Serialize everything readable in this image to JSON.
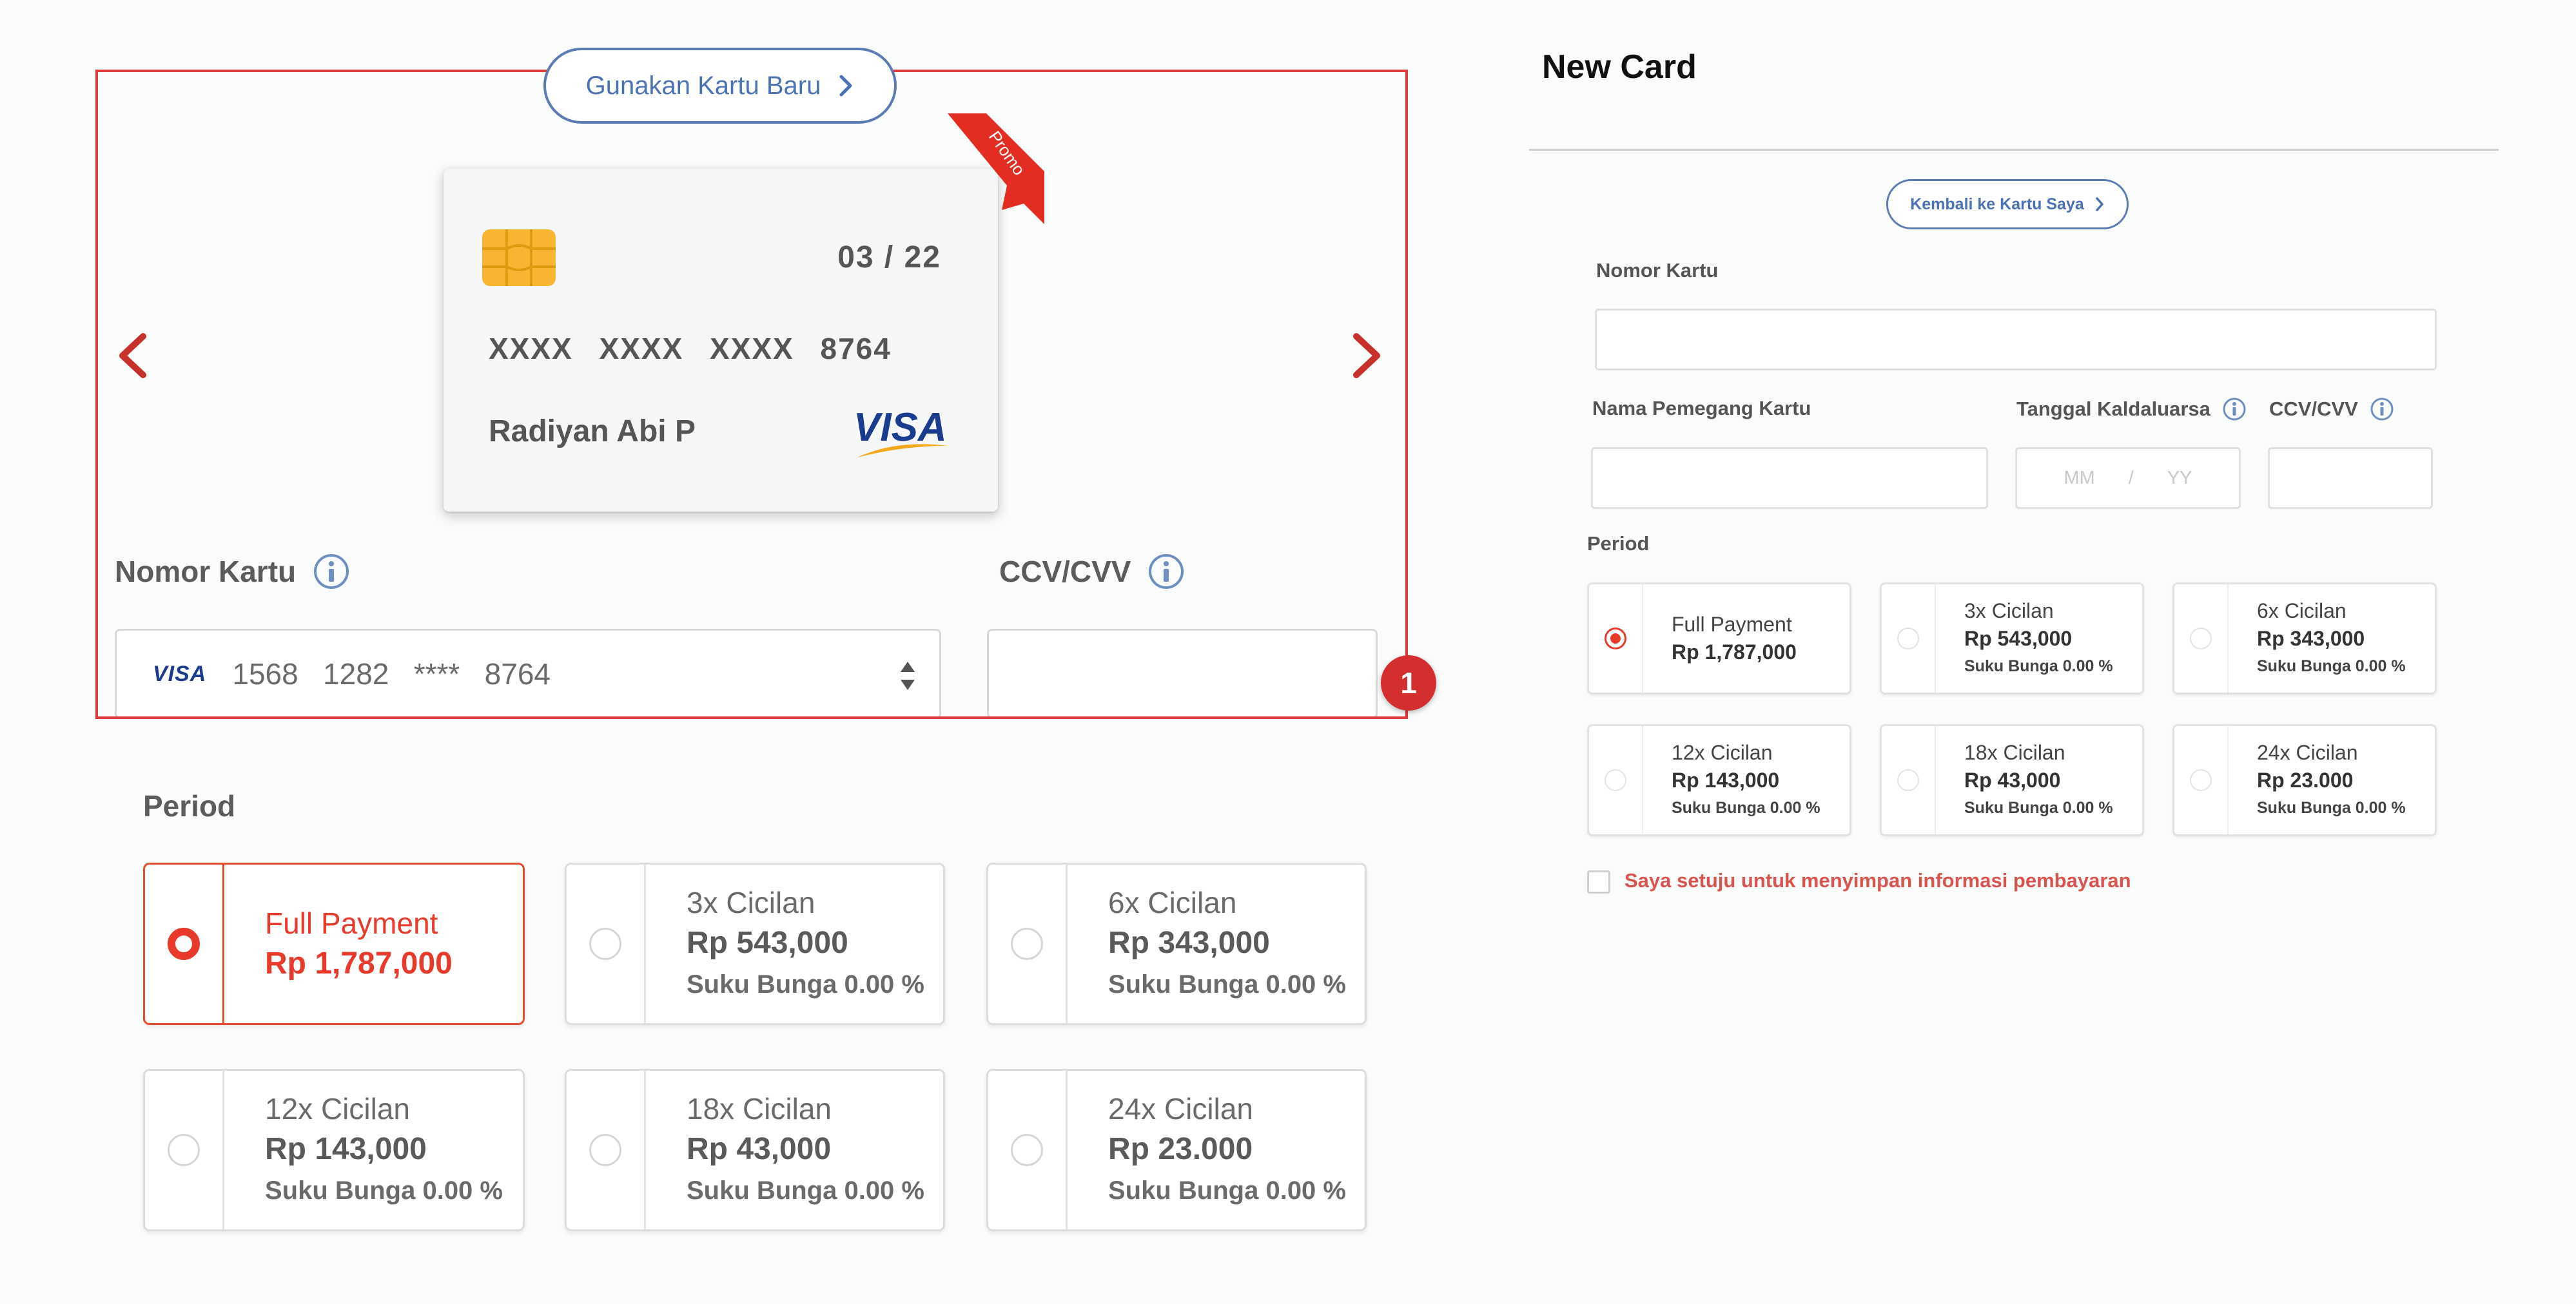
{
  "left_panel": {
    "use_new_card_label": "Gunakan Kartu Baru",
    "card": {
      "expiry": "03 / 22",
      "number": "XXXX XXXX XXXX 8764",
      "holder": "Radiyan Abi P",
      "brand": "VISA",
      "ribbon": "Promo"
    },
    "card_number_label": "Nomor Kartu",
    "card_number_brand": "VISA",
    "card_number_value": "1568   1282   ****   8764",
    "ccv_label": "CCV/CVV",
    "period_label": "Period",
    "badge": "1",
    "options": [
      {
        "title": "Full Payment",
        "amount": "Rp 1,787,000",
        "interest": "",
        "selected": true
      },
      {
        "title": "3x Cicilan",
        "amount": "Rp 543,000",
        "interest": "Suku Bunga 0.00 %",
        "selected": false
      },
      {
        "title": "6x Cicilan",
        "amount": "Rp 343,000",
        "interest": "Suku Bunga 0.00 %",
        "selected": false
      },
      {
        "title": "12x Cicilan",
        "amount": "Rp 143,000",
        "interest": "Suku Bunga 0.00 %",
        "selected": false
      },
      {
        "title": "18x Cicilan",
        "amount": "Rp 43,000",
        "interest": "Suku Bunga 0.00 %",
        "selected": false
      },
      {
        "title": "24x Cicilan",
        "amount": "Rp 23.000",
        "interest": "Suku Bunga 0.00 %",
        "selected": false
      }
    ]
  },
  "right_panel": {
    "title": "New Card",
    "back_label": "Kembali ke Kartu Saya",
    "card_number_label": "Nomor Kartu",
    "holder_label": "Nama Pemegang Kartu",
    "expiry_label": "Tanggal Kaldaluarsa",
    "expiry_mm": "MM",
    "expiry_sep": "/",
    "expiry_yy": "YY",
    "ccv_label": "CCV/CVV",
    "period_label": "Period",
    "options": [
      {
        "title": "Full Payment",
        "amount": "Rp 1,787,000",
        "interest": "",
        "selected": true
      },
      {
        "title": "3x Cicilan",
        "amount": "Rp 543,000",
        "interest": "Suku Bunga 0.00 %",
        "selected": false
      },
      {
        "title": "6x Cicilan",
        "amount": "Rp 343,000",
        "interest": "Suku Bunga 0.00 %",
        "selected": false
      },
      {
        "title": "12x Cicilan",
        "amount": "Rp 143,000",
        "interest": "Suku Bunga 0.00 %",
        "selected": false
      },
      {
        "title": "18x Cicilan",
        "amount": "Rp 43,000",
        "interest": "Suku Bunga 0.00 %",
        "selected": false
      },
      {
        "title": "24x Cicilan",
        "amount": "Rp 23.000",
        "interest": "Suku Bunga 0.00 %",
        "selected": false
      }
    ],
    "save_consent_label": "Saya setuju untuk menyimpan informasi pembayaran"
  },
  "colors": {
    "accent_red": "#e8392a",
    "link_blue": "#4a72b5",
    "highlight_red": "#e0393e"
  }
}
